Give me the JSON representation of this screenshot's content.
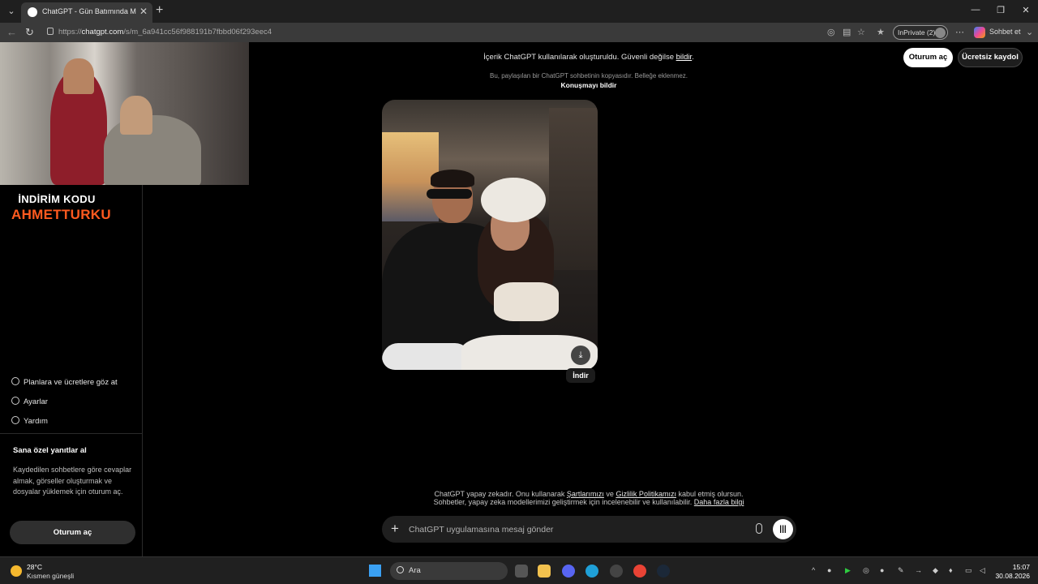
{
  "browser": {
    "tab_title": "ChatGPT - Gün Batımında Modern",
    "url_prefix": "https://",
    "url_host": "chatgpt.com",
    "url_path": "/s/m_6a941cc56f988191b7fbbd06f293eec4",
    "inprivate_label": "InPrivate (2)",
    "chat_label": "Sohbet et"
  },
  "header": {
    "notice_text": "İçerik ChatGPT kullanılarak oluşturuldu. Güvenli değilse ",
    "notice_link": "bildir",
    "notice_end": ".",
    "login_button": "Oturum aç",
    "signup_button": "Ücretsiz kaydol",
    "copy_note": "Bu, paylaşılan bir ChatGPT sohbetinin kopyasıdır. Belleğe eklenmez.",
    "report_link": "Konuşmayı bildir"
  },
  "overlay": {
    "promo_line1": "İNDİRİM KODU",
    "promo_line2": "AHMETTURKU"
  },
  "sidebar": {
    "links": [
      {
        "label": "Planlara ve ücretlere göz at"
      },
      {
        "label": "Ayarlar"
      },
      {
        "label": "Yardım"
      }
    ],
    "promo_title": "Sana özel yanıtlar al",
    "promo_body": "Kaydedilen sohbetlere göre cevaplar almak, görseller oluşturmak ve dosyalar yüklemek için oturum aç.",
    "login_button": "Oturum aç"
  },
  "image": {
    "download_tooltip": "İndir"
  },
  "footer": {
    "line1_a": "ChatGPT yapay zekadır. Onu kullanarak ",
    "terms_link": "Şartlarımızı",
    "line1_b": " ve ",
    "privacy_link": "Gizlilik Politikamızı",
    "line1_c": " kabul etmiş olursun.",
    "line2_a": "Sohbetler, yapay zeka modellerimizi geliştirmek için incelenebilir ve kullanılabilir. ",
    "more_link": "Daha fazla bilgi"
  },
  "composer": {
    "placeholder": "ChatGPT uygulamasına mesaj gönder"
  },
  "taskbar": {
    "weather_temp": "28°C",
    "weather_desc": "Kısmen güneşli",
    "search_label": "Ara",
    "time": "15:07",
    "date": "30.08.2026"
  }
}
